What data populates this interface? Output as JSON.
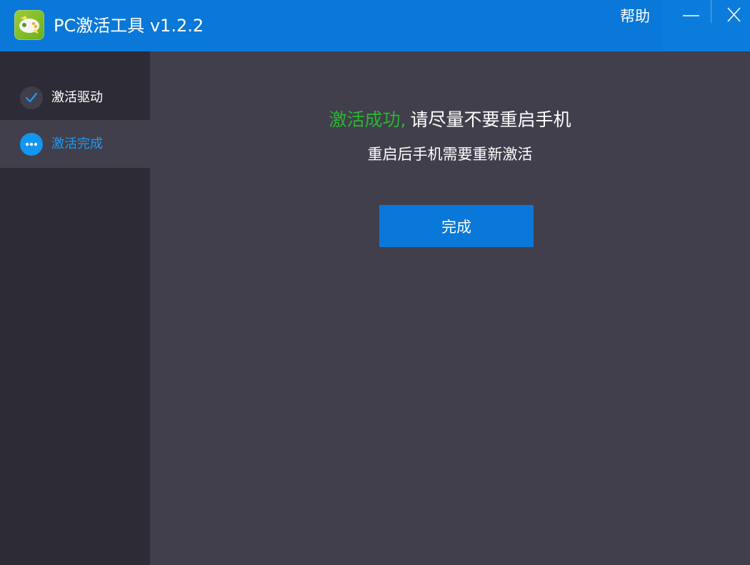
{
  "window": {
    "title": "PC激活工具 v1.2.2",
    "help_label": "帮助",
    "logo_icon": "game-controller-logo",
    "minimize_icon": "minimize-icon",
    "close_icon": "close-icon"
  },
  "sidebar": {
    "steps": [
      {
        "label": "激活驱动",
        "state": "done",
        "icon": "check-icon"
      },
      {
        "label": "激活完成",
        "state": "active",
        "icon": "more-dots-icon"
      }
    ]
  },
  "main": {
    "success_text": "激活成功,",
    "notice_text": "请尽量不要重启手机",
    "sub_text": "重启后手机需要重新激活",
    "finish_button": "完成"
  },
  "colors": {
    "titlebar": "#0a78d8",
    "sidebar": "#2d2c36",
    "content": "#403f4b",
    "success": "#2ab534",
    "active_step": "#1296f2"
  }
}
